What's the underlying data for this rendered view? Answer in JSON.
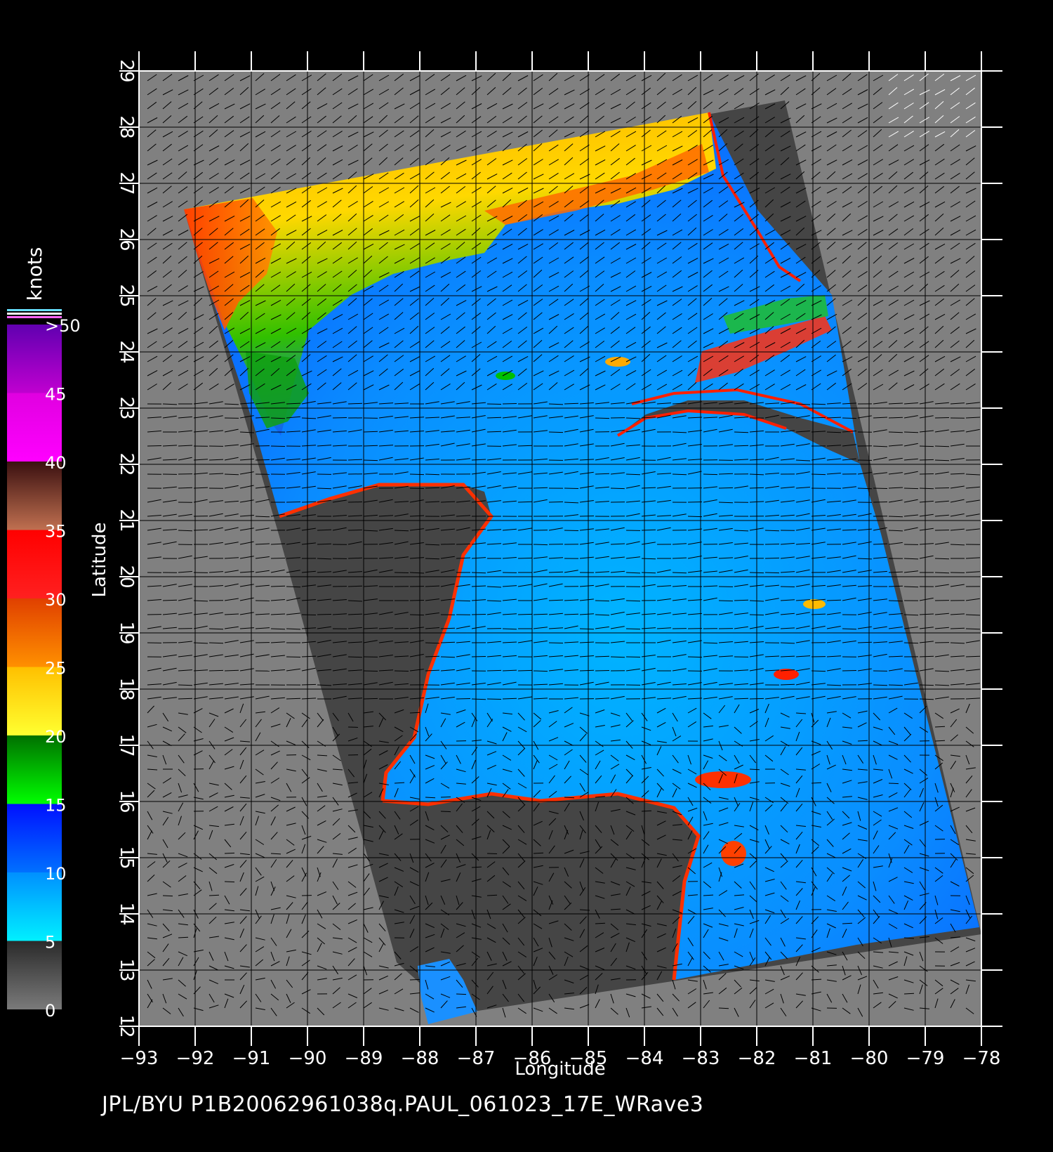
{
  "map": {
    "lon_ticks": [
      -93,
      -92,
      -91,
      -90,
      -89,
      -88,
      -87,
      -86,
      -85,
      -84,
      -83,
      -82,
      -81,
      -80,
      -79,
      -78
    ],
    "lat_ticks": [
      12,
      13,
      14,
      15,
      16,
      17,
      18,
      19,
      20,
      21,
      22,
      23,
      24,
      25,
      26,
      27,
      28,
      29
    ],
    "lon_range": [
      -93,
      -78
    ],
    "lat_range": [
      12,
      29
    ],
    "x_axis_label": "Longitude",
    "y_axis_label": "Latitude",
    "grid": true
  },
  "colorbar": {
    "title": "knots",
    "tick_labels": [
      "0",
      "5",
      "10",
      "15",
      "20",
      "25",
      "30",
      "35",
      "40",
      "45",
      ">50"
    ],
    "segments": [
      {
        "from": 0,
        "to": 5,
        "colors": [
          "#7a7a7a",
          "#2a2a2a"
        ]
      },
      {
        "from": 5,
        "to": 10,
        "colors": [
          "#00f0ff",
          "#0090ff"
        ]
      },
      {
        "from": 10,
        "to": 15,
        "colors": [
          "#0070ff",
          "#0010ff"
        ]
      },
      {
        "from": 15,
        "to": 20,
        "colors": [
          "#00ff00",
          "#007000"
        ]
      },
      {
        "from": 20,
        "to": 25,
        "colors": [
          "#ffff30",
          "#ffc000"
        ]
      },
      {
        "from": 25,
        "to": 30,
        "colors": [
          "#ff9000",
          "#e04000"
        ]
      },
      {
        "from": 30,
        "to": 35,
        "colors": [
          "#ff2020",
          "#ff0000"
        ]
      },
      {
        "from": 35,
        "to": 40,
        "colors": [
          "#c07050",
          "#3a1010"
        ]
      },
      {
        "from": 40,
        "to": 45,
        "colors": [
          "#ff00ff",
          "#e000e0"
        ]
      },
      {
        "from": 45,
        "to": 50,
        "colors": [
          "#c000d0",
          "#6000b0"
        ]
      }
    ]
  },
  "legend_colors": {
    "background": "#000000",
    "no_data": "#808080",
    "land": "#454545",
    "grid_line": "#000000"
  },
  "footer_text": "JPL/BYU  P1B20062961038q.PAUL_061023_17E_WRave3"
}
